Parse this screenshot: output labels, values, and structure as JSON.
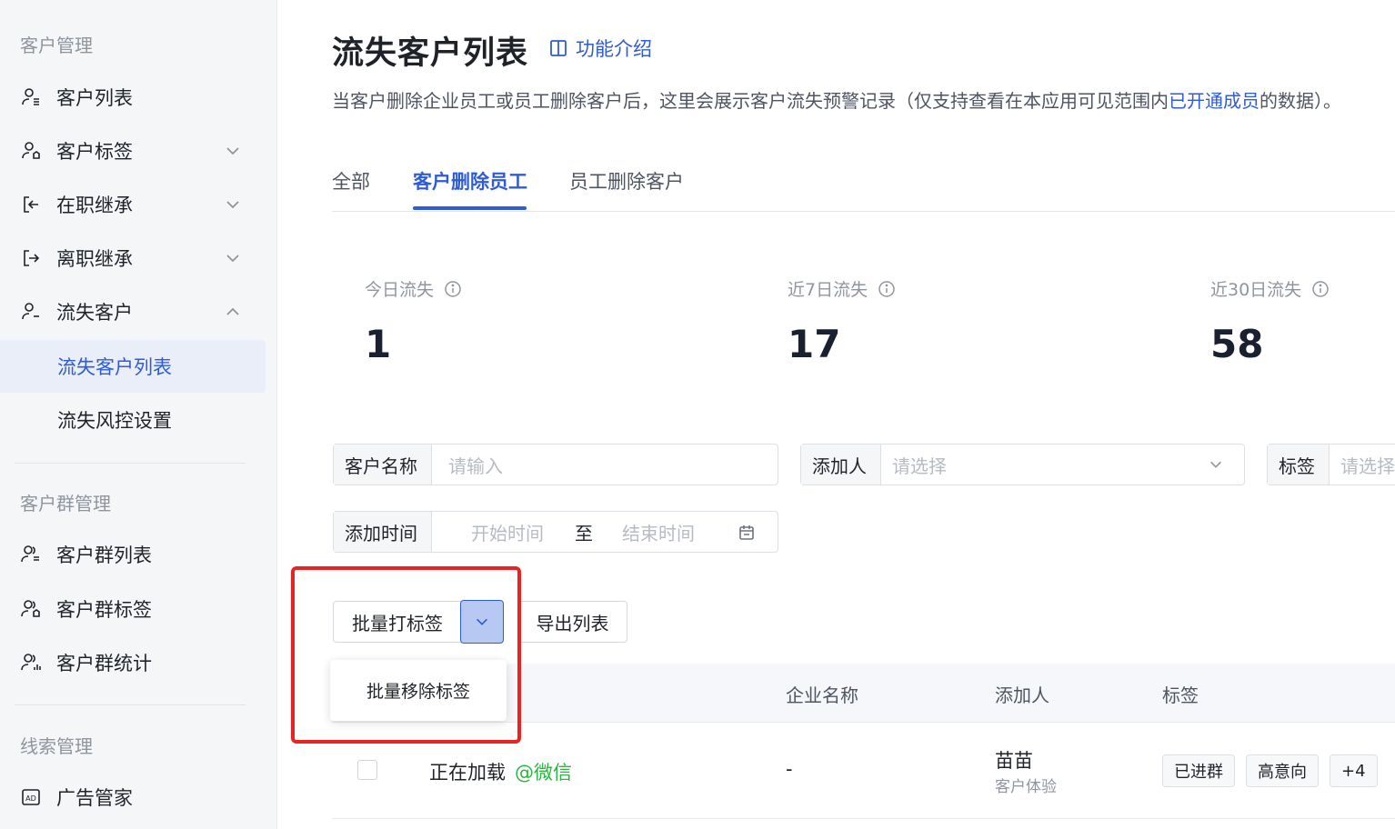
{
  "sidebar": {
    "sections": [
      {
        "title": "客户管理"
      },
      {
        "title": "客户群管理"
      },
      {
        "title": "线索管理"
      }
    ],
    "items": [
      {
        "label": "客户列表",
        "icon": "user-list-icon"
      },
      {
        "label": "客户标签",
        "icon": "user-tag-icon"
      },
      {
        "label": "在职继承",
        "icon": "login-icon"
      },
      {
        "label": "离职继承",
        "icon": "logout-icon"
      },
      {
        "label": "流失客户",
        "icon": "user-lost-icon"
      },
      {
        "label": "流失客户列表"
      },
      {
        "label": "流失风控设置"
      },
      {
        "label": "客户群列表",
        "icon": "group-list-icon"
      },
      {
        "label": "客户群标签",
        "icon": "group-tag-icon"
      },
      {
        "label": "客户群统计",
        "icon": "group-stats-icon"
      },
      {
        "label": "广告管家",
        "icon": "ad-icon"
      }
    ]
  },
  "header": {
    "title": "流失客户列表",
    "feature_link": "功能介绍",
    "desc_before": "当客户删除企业员工或员工删除客户后，这里会展示客户流失预警记录（仅支持查看在本应用可见范围内",
    "desc_link": "已开通成员",
    "desc_after": "的数据）。"
  },
  "tabs": [
    {
      "label": "全部",
      "active": false
    },
    {
      "label": "客户删除员工",
      "active": true
    },
    {
      "label": "员工删除客户",
      "active": false
    }
  ],
  "stats": [
    {
      "label": "今日流失",
      "value": "1"
    },
    {
      "label": "近7日流失",
      "value": "17"
    },
    {
      "label": "近30日流失",
      "value": "58"
    }
  ],
  "filters": {
    "customer_name": {
      "label": "客户名称",
      "placeholder": "请输入"
    },
    "adder": {
      "label": "添加人",
      "placeholder": "请选择"
    },
    "tag": {
      "label": "标签",
      "placeholder": "请选择"
    },
    "add_time": {
      "label": "添加时间",
      "start_placeholder": "开始时间",
      "separator": "至",
      "end_placeholder": "结束时间"
    }
  },
  "actions": {
    "batch_tag": "批量打标签",
    "export": "导出列表",
    "dropdown_item": "批量移除标签"
  },
  "table": {
    "columns": [
      "企业名称",
      "添加人",
      "标签"
    ],
    "rows": [
      {
        "name": "正在加载",
        "source": "@微信",
        "corp": "-",
        "adder": "苗苗",
        "adder_sub": "客户体验",
        "tags": [
          "已进群",
          "高意向",
          "+4"
        ]
      }
    ]
  },
  "colors": {
    "accent": "#2e5bd8",
    "wechat": "#2bb541",
    "highlight": "#ea2222"
  }
}
